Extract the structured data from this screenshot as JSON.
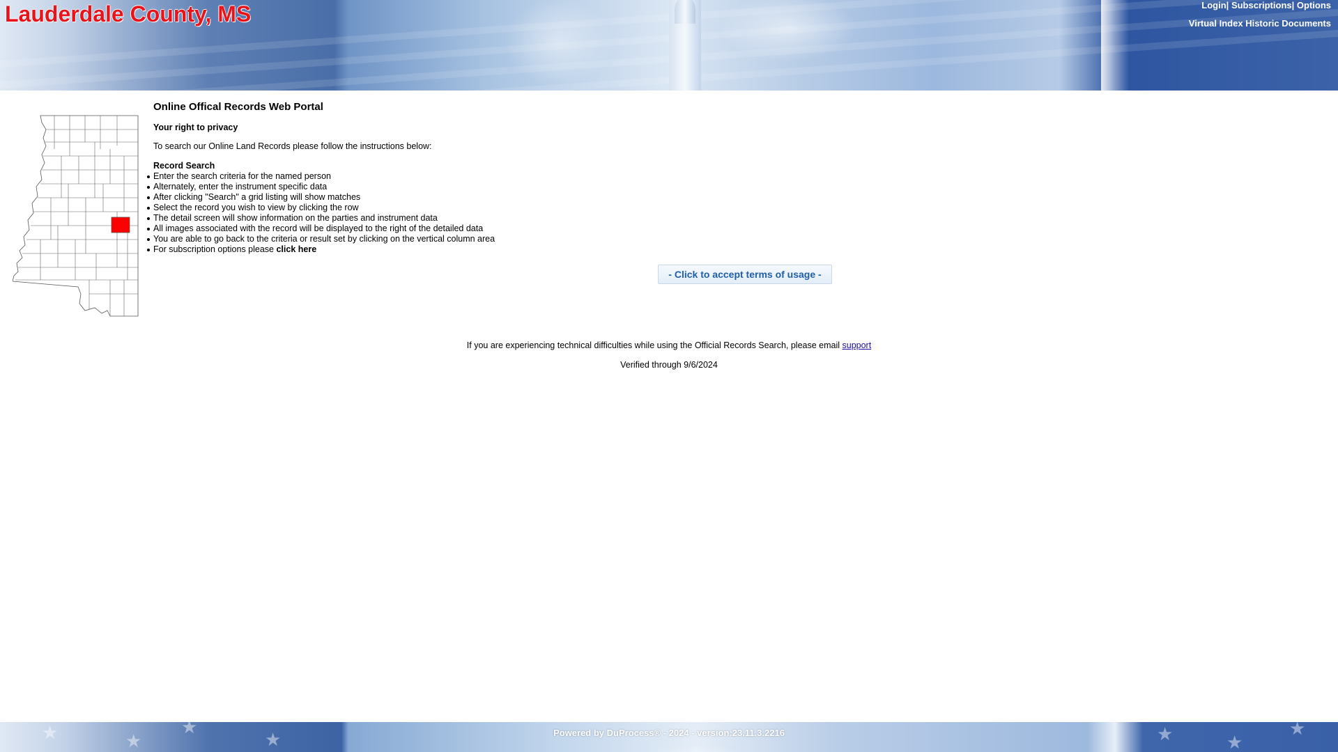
{
  "header": {
    "county_title": "Lauderdale County, MS",
    "nav": {
      "login": "Login",
      "sep1": "|",
      "subscriptions": "Subscriptions",
      "sep2": "|",
      "options": "Options",
      "virtual_index": "Virtual Index Historic Documents"
    }
  },
  "map": {
    "highlight_color": "#ff0000",
    "icon": "mississippi-county-map"
  },
  "main": {
    "portal_title": "Online Offical Records Web Portal",
    "privacy_heading": "Your right to privacy",
    "intro": "To search our Online Land Records please follow the instructions below:",
    "record_search_heading": "Record Search",
    "instructions": [
      "Enter the search criteria for the named person",
      "Alternately, enter the instrument specific data",
      "After clicking \"Search\" a grid listing will show matches",
      "Select the record you wish to view by clicking the row",
      "The detail screen will show information on the parties and instrument data",
      "All images associated with the record will be displayed to the right of the detailed data",
      "You are able to go back to the criteria or result set by clicking on the vertical column area"
    ],
    "subscription_text": "For subscription options please ",
    "subscription_link": "click here",
    "accept_button": "- Click to accept terms of usage -",
    "support_text": "If you are experiencing technical difficulties while using the Official Records Search, please email ",
    "support_link": "support",
    "verified": "Verified through 9/6/2024"
  },
  "footer": {
    "powered_by": "Powered by DuProcess® - 2024 - version:23.11.3.2216"
  },
  "colors": {
    "title_red": "#e8141b",
    "link_blue": "#1a0dab",
    "button_text": "#1e5fa6"
  }
}
